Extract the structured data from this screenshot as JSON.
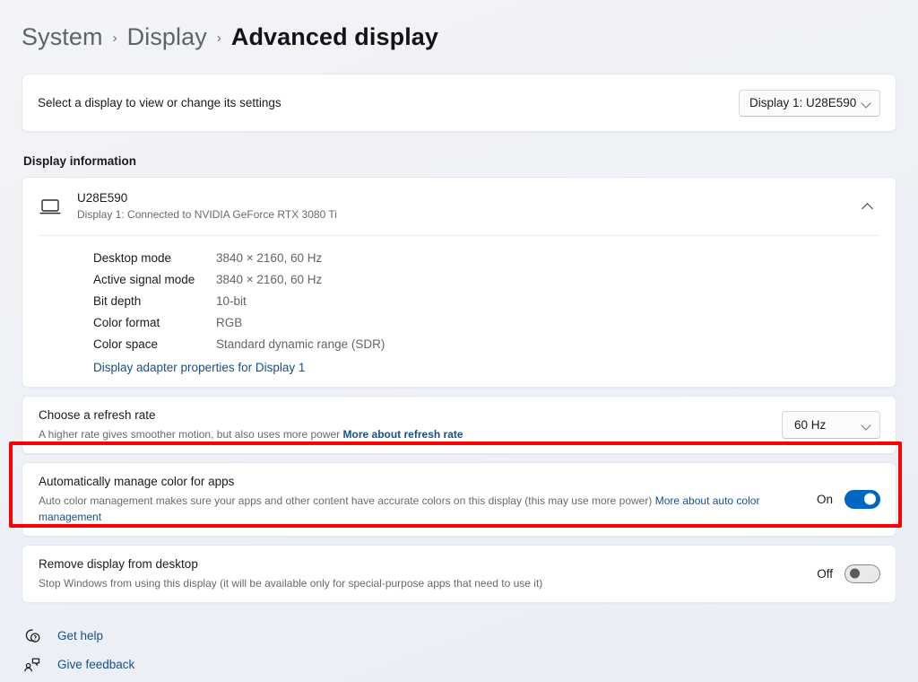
{
  "breadcrumb": {
    "items": [
      "System",
      "Display",
      "Advanced display"
    ],
    "separator": "›"
  },
  "display_selector": {
    "label": "Select a display to view or change its settings",
    "selected": "Display 1: U28E590",
    "chevron_icon": "chevron-down-icon"
  },
  "display_information": {
    "section_heading": "Display information",
    "monitor_icon": "monitor-icon",
    "title": "U28E590",
    "subtitle": "Display 1: Connected to NVIDIA GeForce RTX 3080 Ti",
    "expand_icon": "chevron-up-icon",
    "details": [
      {
        "key": "Desktop mode",
        "value": "3840 × 2160, 60 Hz"
      },
      {
        "key": "Active signal mode",
        "value": "3840 × 2160, 60 Hz"
      },
      {
        "key": "Bit depth",
        "value": "10-bit"
      },
      {
        "key": "Color format",
        "value": "RGB"
      },
      {
        "key": "Color space",
        "value": "Standard dynamic range (SDR)"
      }
    ],
    "adapter_link": "Display adapter properties for Display 1"
  },
  "refresh_rate": {
    "title": "Choose a refresh rate",
    "desc": "A higher rate gives smoother motion, but also uses more power",
    "link": "More about refresh rate",
    "selected": "60 Hz",
    "chevron_icon": "chevron-down-icon"
  },
  "auto_color": {
    "title": "Automatically manage color for apps",
    "desc": "Auto color management makes sure your apps and other content have accurate colors on this display (this may use more power)",
    "link": "More about auto color management",
    "state_label": "On",
    "state": "on",
    "accent_color": "#0067C0"
  },
  "remove_display": {
    "title": "Remove display from desktop",
    "desc": "Stop Windows from using this display (it will be available only for special-purpose apps that need to use it)",
    "state_label": "Off",
    "state": "off"
  },
  "footer": {
    "get_help": {
      "label": "Get help",
      "icon": "help-question-icon"
    },
    "give_feedback": {
      "label": "Give feedback",
      "icon": "feedback-person-icon"
    }
  },
  "annotation": {
    "type": "highlight-rectangle",
    "color": "#FF0000",
    "target": "auto-color-management-setting"
  }
}
